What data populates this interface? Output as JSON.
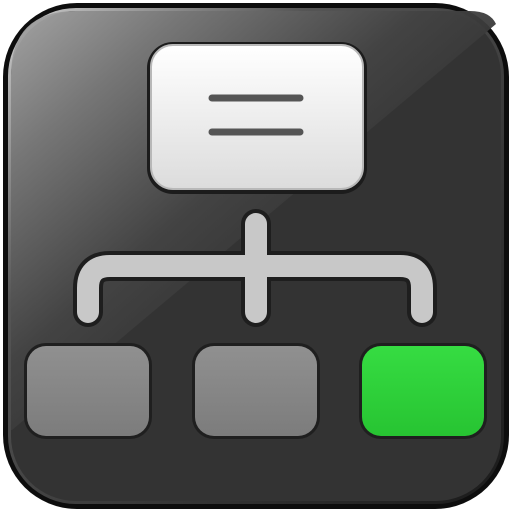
{
  "icon": {
    "name": "hierarchy-flowchart-icon",
    "colors": {
      "tile_dark": "#333333",
      "tile_border": "#0f0f0f",
      "gloss_highlight": "#9a9a9a",
      "root_box_top": "#ffffff",
      "root_box_bottom": "#dedede",
      "root_box_lines": "#555555",
      "connector": "#c9c9c9",
      "connector_shadow": "#222222",
      "child_box_gray": "#858585",
      "child_box_active": "#2ed13a"
    },
    "children": [
      {
        "name": "child-node-left",
        "state": "inactive"
      },
      {
        "name": "child-node-center",
        "state": "inactive"
      },
      {
        "name": "child-node-right",
        "state": "active"
      }
    ]
  }
}
